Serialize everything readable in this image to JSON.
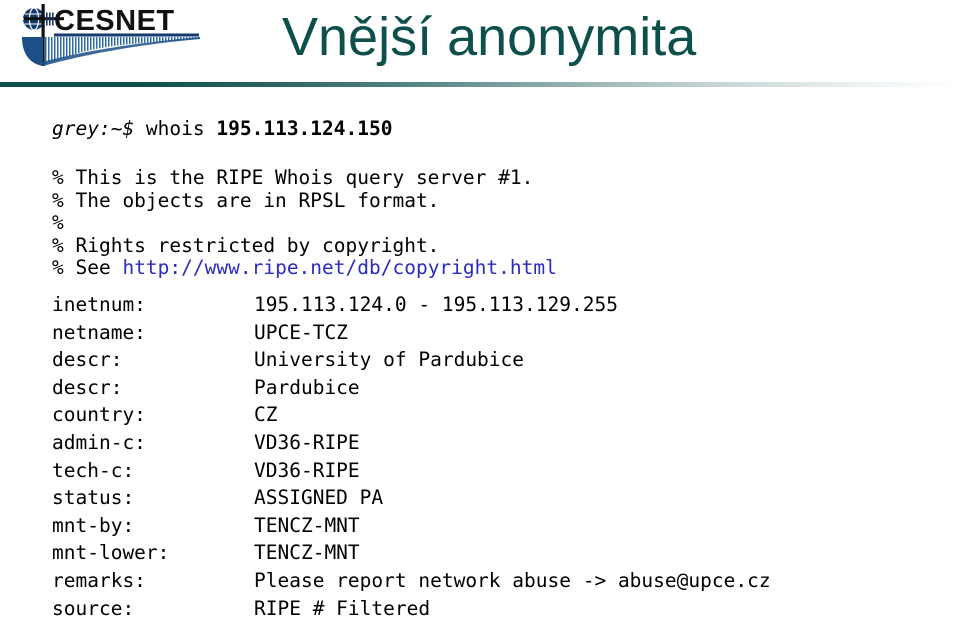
{
  "header": {
    "title": "Vnější anonymita",
    "logo_text": "CESNET",
    "title_color": "#0d4f4a",
    "rule_color": "#0c4f4a"
  },
  "terminal": {
    "prompt": "grey:~$",
    "command": " whois ",
    "argument": "195.113.124.150",
    "banner_lines": [
      {
        "pre": "% This is the RIPE Whois query server #1.",
        "link": "",
        "post": ""
      },
      {
        "pre": "% The objects are in RPSL format.",
        "link": "",
        "post": ""
      },
      {
        "pre": "%",
        "link": "",
        "post": ""
      },
      {
        "pre": "% Rights restricted by copyright.",
        "link": "",
        "post": ""
      },
      {
        "pre": "% See ",
        "link": "http://www.ripe.net/db/copyright.html",
        "post": ""
      }
    ],
    "link_color": "#2b2bbf",
    "record": [
      {
        "key": "inetnum:",
        "value": "195.113.124.0 - 195.113.129.255"
      },
      {
        "key": "netname:",
        "value": "UPCE-TCZ"
      },
      {
        "key": "descr:",
        "value": "University of Pardubice"
      },
      {
        "key": "descr:",
        "value": "Pardubice"
      },
      {
        "key": "country:",
        "value": "CZ"
      },
      {
        "key": "admin-c:",
        "value": "VD36-RIPE"
      },
      {
        "key": "tech-c:",
        "value": "VD36-RIPE"
      },
      {
        "key": "status:",
        "value": "ASSIGNED PA"
      },
      {
        "key": "mnt-by:",
        "value": "TENCZ-MNT"
      },
      {
        "key": "mnt-lower:",
        "value": "TENCZ-MNT"
      },
      {
        "key": "remarks:",
        "value": "Please report network abuse -> abuse@upce.cz"
      },
      {
        "key": "source:",
        "value": "RIPE # Filtered"
      }
    ]
  }
}
